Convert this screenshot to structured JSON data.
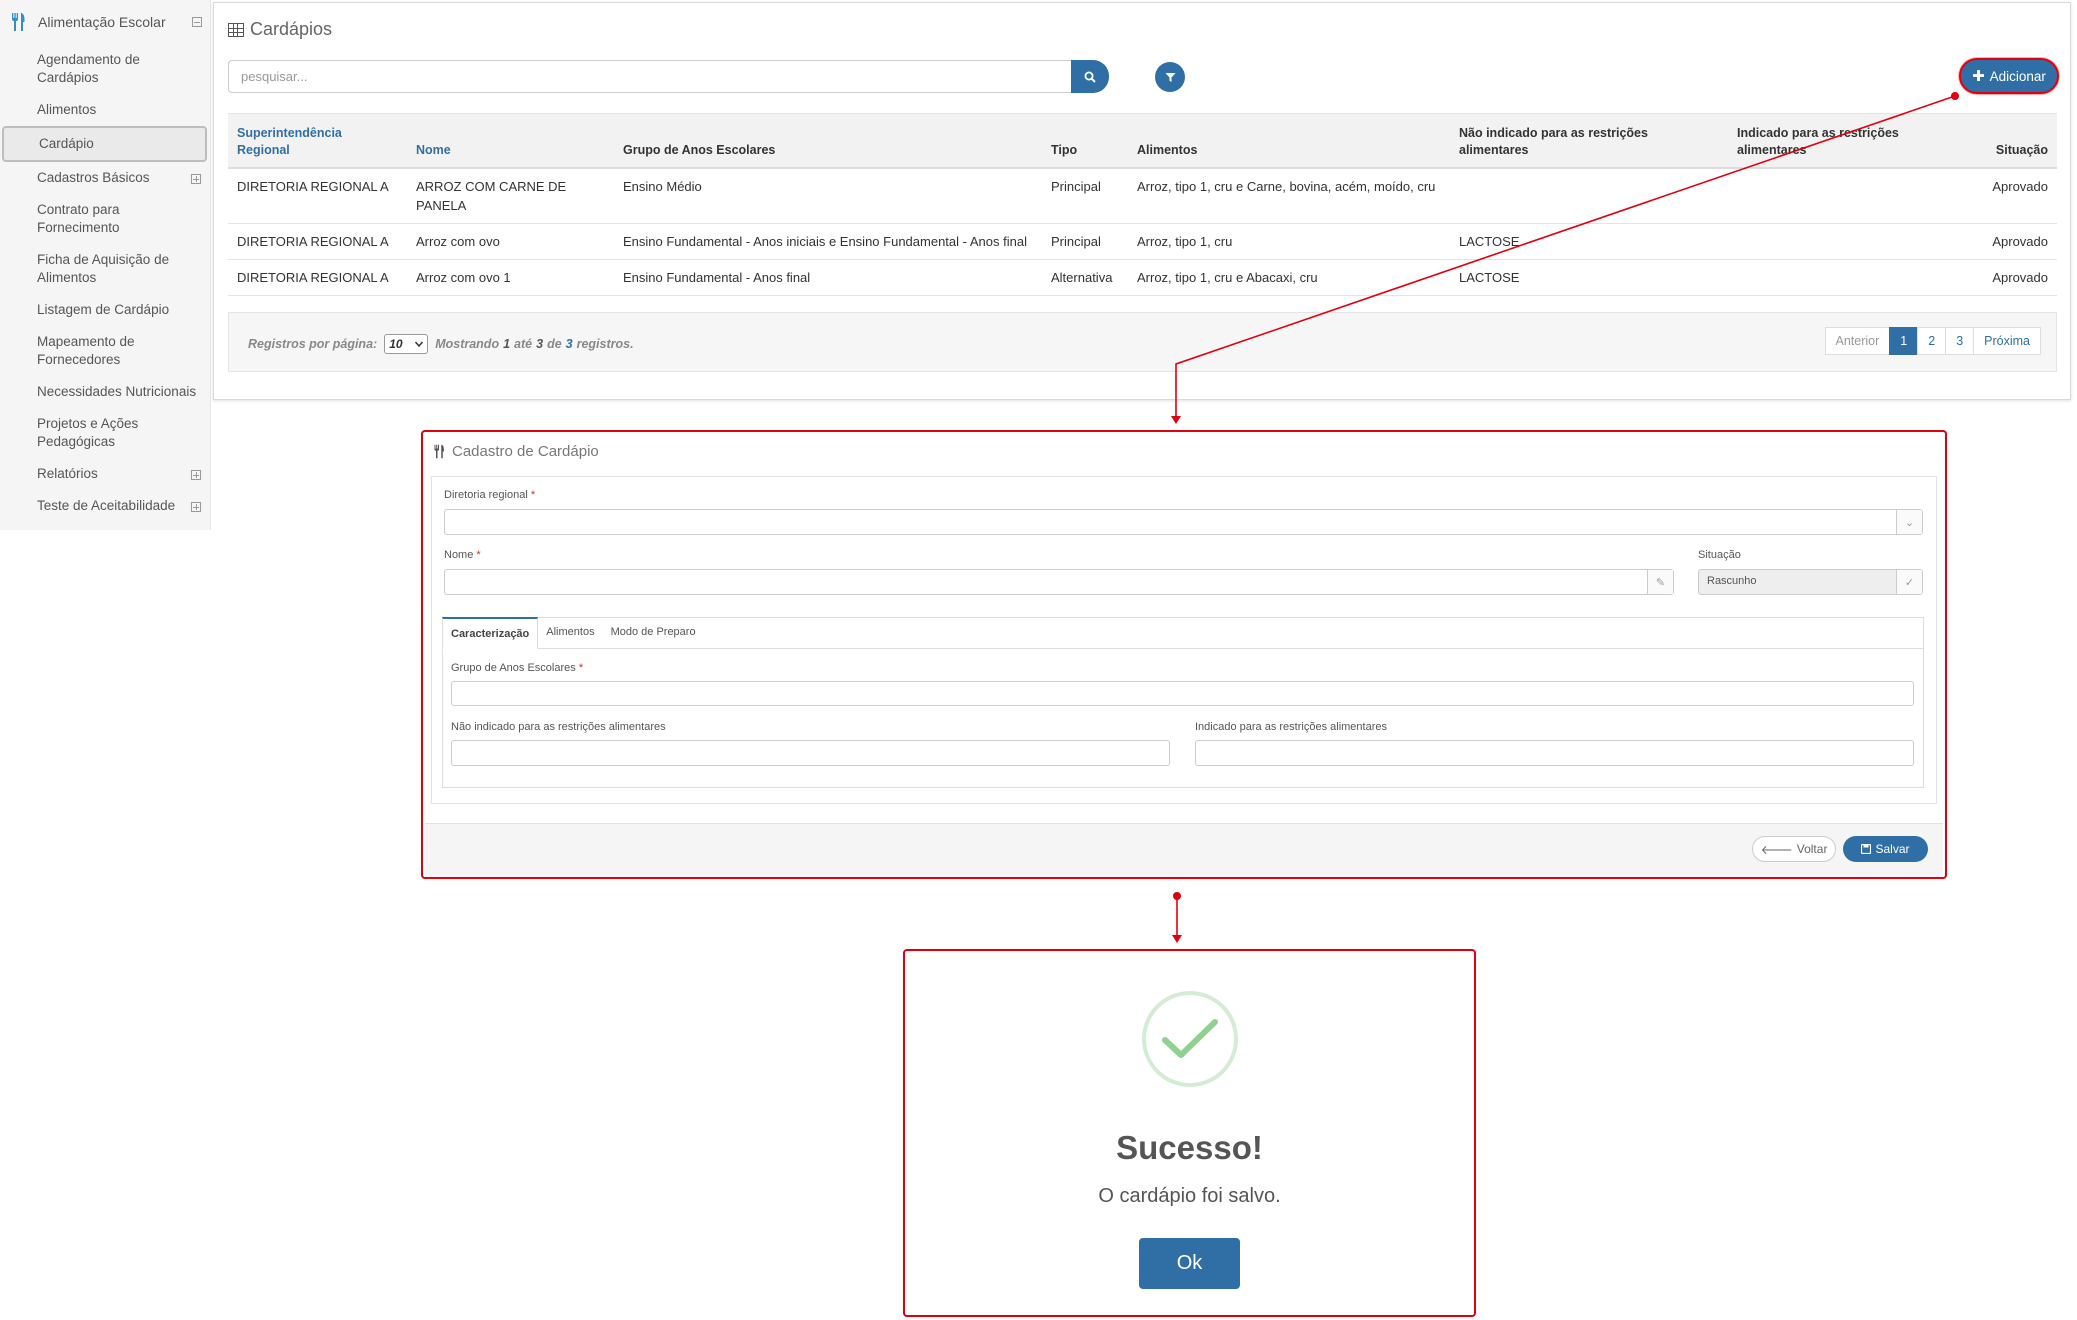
{
  "sidebar": {
    "title": "Alimentação Escolar",
    "items": [
      {
        "label": "Agendamento de Cardápios"
      },
      {
        "label": "Alimentos"
      },
      {
        "label": "Cardápio"
      },
      {
        "label": "Cadastros Básicos"
      },
      {
        "label": "Contrato para Fornecimento"
      },
      {
        "label": "Ficha de Aquisição de Alimentos"
      },
      {
        "label": "Listagem de Cardápio"
      },
      {
        "label": "Mapeamento de Fornecedores"
      },
      {
        "label": "Necessidades Nutricionais"
      },
      {
        "label": "Projetos e Ações Pedagógicas"
      },
      {
        "label": "Relatórios"
      },
      {
        "label": "Teste de Aceitabilidade"
      }
    ]
  },
  "list": {
    "title": "Cardápios",
    "search_placeholder": "pesquisar...",
    "add_label": "Adicionar",
    "columns": [
      "Superintendência Regional",
      "Nome",
      "Grupo de Anos Escolares",
      "Tipo",
      "Alimentos",
      "Não indicado para as restrições alimentares",
      "Indicado para as restrições alimentares",
      "Situação"
    ],
    "rows": [
      [
        "DIRETORIA REGIONAL A",
        "ARROZ COM CARNE DE PANELA",
        "Ensino Médio",
        "Principal",
        "Arroz, tipo 1, cru e Carne, bovina, acém, moído, cru",
        "",
        "",
        "Aprovado"
      ],
      [
        "DIRETORIA REGIONAL A",
        "Arroz com ovo",
        "Ensino Fundamental - Anos iniciais e Ensino Fundamental - Anos final",
        "Principal",
        "Arroz, tipo 1, cru",
        "LACTOSE",
        "",
        "Aprovado"
      ],
      [
        "DIRETORIA REGIONAL A",
        "Arroz com ovo 1",
        "Ensino Fundamental - Anos final",
        "Alternativa",
        "Arroz, tipo 1, cru e Abacaxi, cru",
        "LACTOSE",
        "",
        "Aprovado"
      ]
    ],
    "footer": {
      "per_page_label": "Registros por página:",
      "per_page_value": "10",
      "showing": "Mostrando",
      "from": "1",
      "to_word": "até",
      "to": "3",
      "of_word": "de",
      "total": "3",
      "records_word": "registros."
    },
    "pager": {
      "prev": "Anterior",
      "pages": [
        "1",
        "2",
        "3"
      ],
      "next": "Próxima",
      "current": "1"
    }
  },
  "form": {
    "title": "Cadastro de Cardápio",
    "diretoria_label": "Diretoria regional",
    "nome_label": "Nome",
    "situacao_label": "Situação",
    "situacao_value": "Rascunho",
    "tabs": [
      "Caracterização",
      "Alimentos",
      "Modo de Preparo"
    ],
    "grupo_label": "Grupo de Anos Escolares",
    "nao_indicado_label": "Não indicado para as restrições alimentares",
    "indicado_label": "Indicado para as restrições alimentares",
    "required_mark": "*",
    "voltar_label": "Voltar",
    "salvar_label": "Salvar"
  },
  "modal": {
    "title": "Sucesso!",
    "message": "O cardápio foi salvo.",
    "ok_label": "Ok"
  },
  "colors": {
    "primary": "#2f6fa6",
    "highlight": "#e0000f",
    "success": "#8fd18f"
  }
}
